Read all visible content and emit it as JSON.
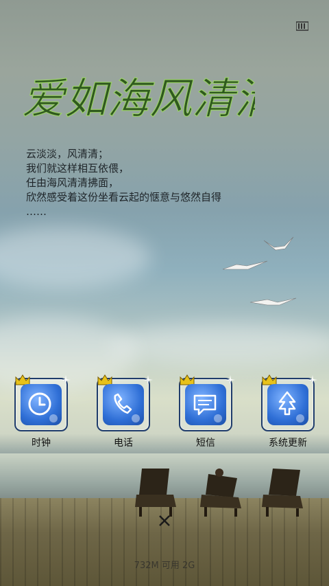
{
  "title_art": "爱如海风清清",
  "poem": {
    "line1": "云淡淡，风清清；",
    "line2": "我们就这样相互依偎，",
    "line3": "任由海风清清拂面，",
    "line4": "欣然感受着这份坐看云起的惬意与悠然自得",
    "line5": "……"
  },
  "apps": [
    {
      "label": "时钟",
      "icon": "clock-icon"
    },
    {
      "label": "电话",
      "icon": "phone-icon"
    },
    {
      "label": "短信",
      "icon": "message-icon"
    },
    {
      "label": "系统更新",
      "icon": "update-icon"
    }
  ],
  "footer": "732M 可用 2G",
  "colors": {
    "accent": "#2f6fd6",
    "tile_border": "#1f3c6b",
    "crown": "#e8c21a"
  }
}
